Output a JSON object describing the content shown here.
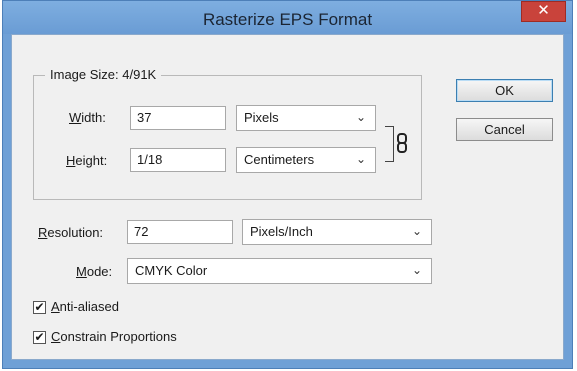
{
  "window": {
    "title": "Rasterize EPS Format",
    "close_glyph": "✕"
  },
  "image_size": {
    "label": "Image Size: 4/91K"
  },
  "width": {
    "label_u": "W",
    "label_rest": "idth:",
    "value": "37",
    "unit": "Pixels"
  },
  "height": {
    "label_u": "H",
    "label_rest": "eight:",
    "value": "1/18",
    "unit": "Centimeters"
  },
  "resolution": {
    "label_u": "R",
    "label_rest": "esolution:",
    "value": "72",
    "unit": "Pixels/Inch"
  },
  "mode": {
    "label_pre": "",
    "label_u": "M",
    "label_rest": "ode:",
    "value": "CMYK Color"
  },
  "options": {
    "anti_aliased": {
      "label_u": "A",
      "label_rest": "nti-aliased",
      "checked": true
    },
    "constrain": {
      "label_u": "C",
      "label_rest": "onstrain Proportions",
      "checked": true
    }
  },
  "buttons": {
    "ok": "OK",
    "cancel": "Cancel"
  },
  "glyphs": {
    "dropdown": "⌄",
    "check": "✔"
  },
  "icons": [
    "close-icon",
    "chevron-down-icon",
    "link-icon",
    "checkmark-icon"
  ]
}
